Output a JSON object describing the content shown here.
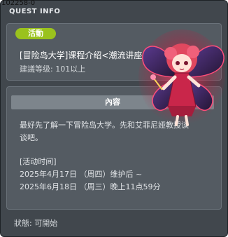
{
  "window": {
    "id_label": "102258-0",
    "title": "QUEST INFO"
  },
  "quest": {
    "badge": "活動",
    "name": "[冒险岛大学]课程介绍<潮流讲座>",
    "level": "建議等级: 101以上"
  },
  "content": {
    "header": "內容",
    "lines": [
      "最好先了解一下冒险岛大学。先和艾菲尼娅教授谈",
      "谈吧。",
      "[活动时间]",
      "2025年4月17日 （周四）维护后 ~",
      "2025年6月18日 （周三）晚上11点59分"
    ]
  },
  "status": "狀態: 可開始",
  "colors": {
    "badge": "#9ac21d",
    "window_bg": "#41474d",
    "panel_bg": "#545b62",
    "header_bg": "#7d858c"
  },
  "icons": {
    "character": "fairy-npc-icon"
  }
}
